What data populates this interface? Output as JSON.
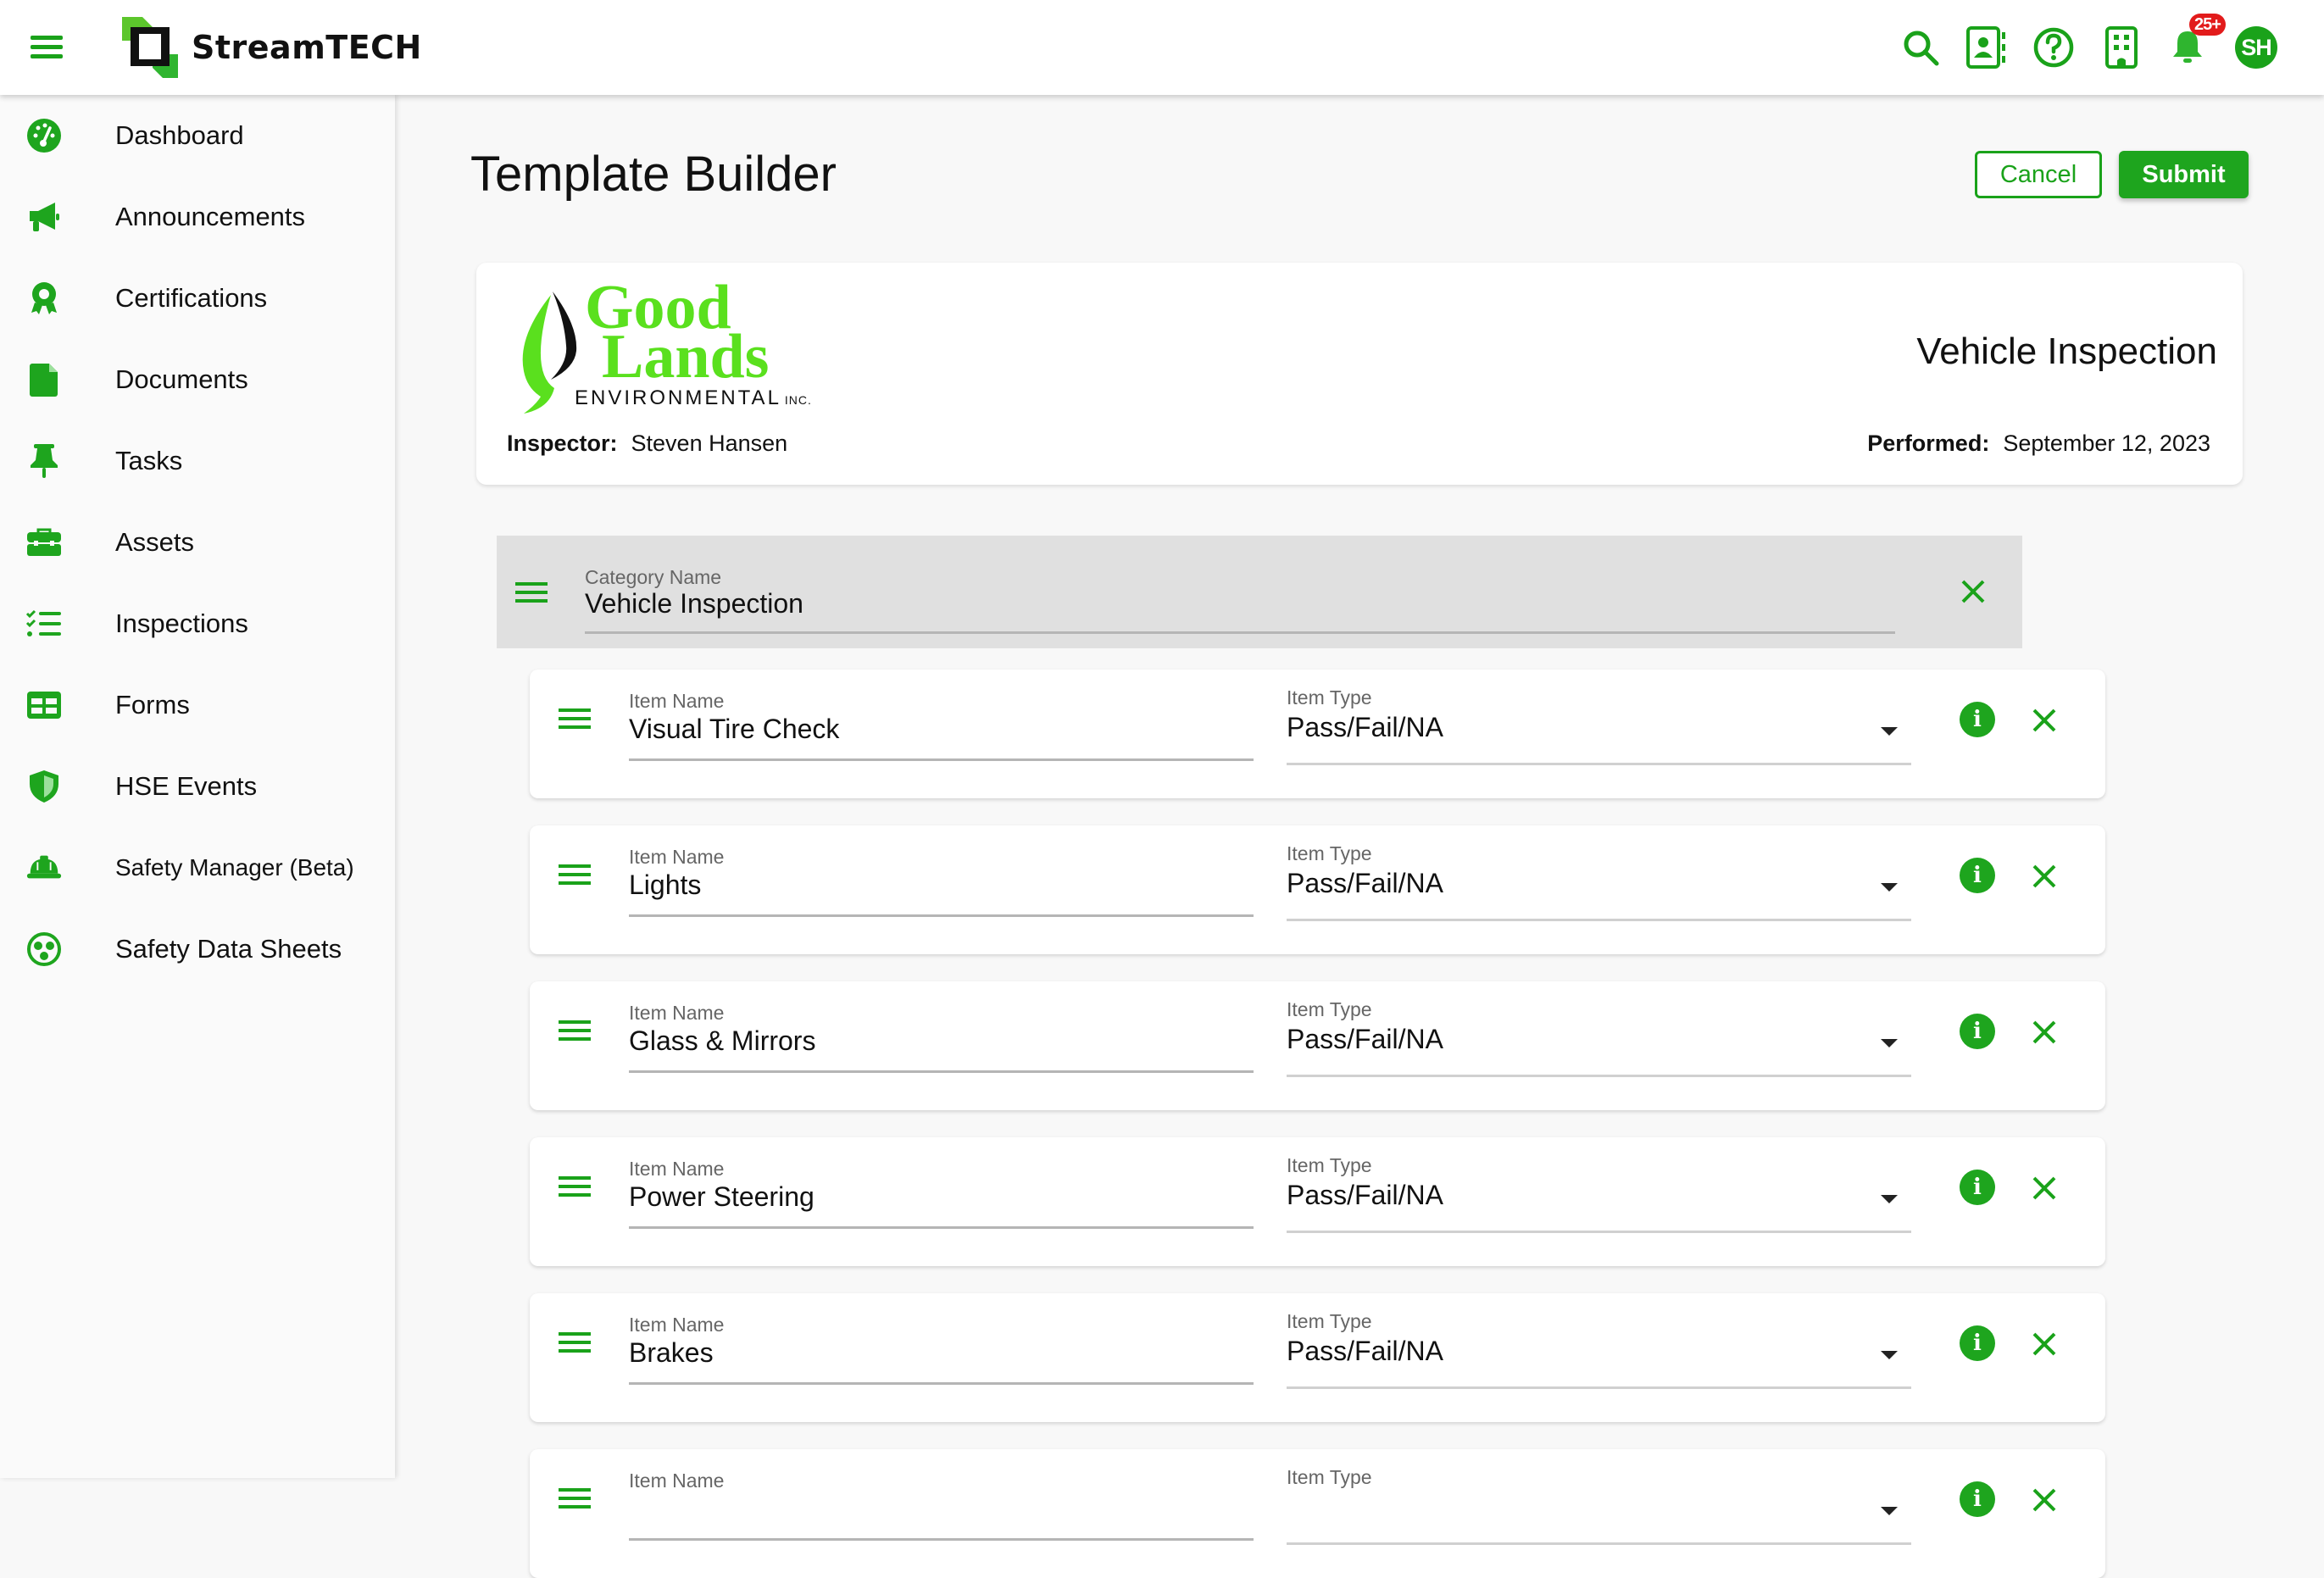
{
  "app": {
    "brand_name": "StreamTECH",
    "accent_color": "#1aa21a",
    "badge_color": "#e21b1b"
  },
  "topbar": {
    "icons": [
      "search-icon",
      "contacts-icon",
      "help-icon",
      "building-icon",
      "bell-icon"
    ],
    "notification_badge": "25+",
    "avatar_initials": "SH"
  },
  "sidebar": {
    "items": [
      {
        "label": "Dashboard",
        "icon": "dashboard-icon"
      },
      {
        "label": "Announcements",
        "icon": "megaphone-icon"
      },
      {
        "label": "Certifications",
        "icon": "award-icon"
      },
      {
        "label": "Documents",
        "icon": "document-icon"
      },
      {
        "label": "Tasks",
        "icon": "pin-icon"
      },
      {
        "label": "Assets",
        "icon": "toolbox-icon"
      },
      {
        "label": "Inspections",
        "icon": "checklist-icon"
      },
      {
        "label": "Forms",
        "icon": "table-icon"
      },
      {
        "label": "HSE Events",
        "icon": "shield-icon"
      },
      {
        "label": "Safety Manager (Beta)",
        "icon": "hardhat-icon"
      },
      {
        "label": "Safety Data Sheets",
        "icon": "hazard-icon"
      }
    ]
  },
  "page": {
    "title": "Template Builder",
    "cancel_label": "Cancel",
    "submit_label": "Submit"
  },
  "header_card": {
    "logo": {
      "line1": "Good",
      "line2": "Lands",
      "line3": "ENVIRONMENTAL",
      "suffix": "INC."
    },
    "form_title": "Vehicle Inspection",
    "inspector_label": "Inspector:",
    "inspector_value": "Steven Hansen",
    "performed_label": "Performed:",
    "performed_value": "September 12, 2023"
  },
  "category": {
    "label": "Category Name",
    "value": "Vehicle Inspection"
  },
  "items": [
    {
      "name_label": "Item Name",
      "name": "Visual Tire Check",
      "type_label": "Item Type",
      "type": "Pass/Fail/NA"
    },
    {
      "name_label": "Item Name",
      "name": "Lights",
      "type_label": "Item Type",
      "type": "Pass/Fail/NA"
    },
    {
      "name_label": "Item Name",
      "name": "Glass & Mirrors",
      "type_label": "Item Type",
      "type": "Pass/Fail/NA"
    },
    {
      "name_label": "Item Name",
      "name": "Power Steering",
      "type_label": "Item Type",
      "type": "Pass/Fail/NA"
    },
    {
      "name_label": "Item Name",
      "name": "Brakes",
      "type_label": "Item Type",
      "type": "Pass/Fail/NA"
    },
    {
      "name_label": "Item Name",
      "name": "",
      "type_label": "Item Type",
      "type": ""
    }
  ]
}
